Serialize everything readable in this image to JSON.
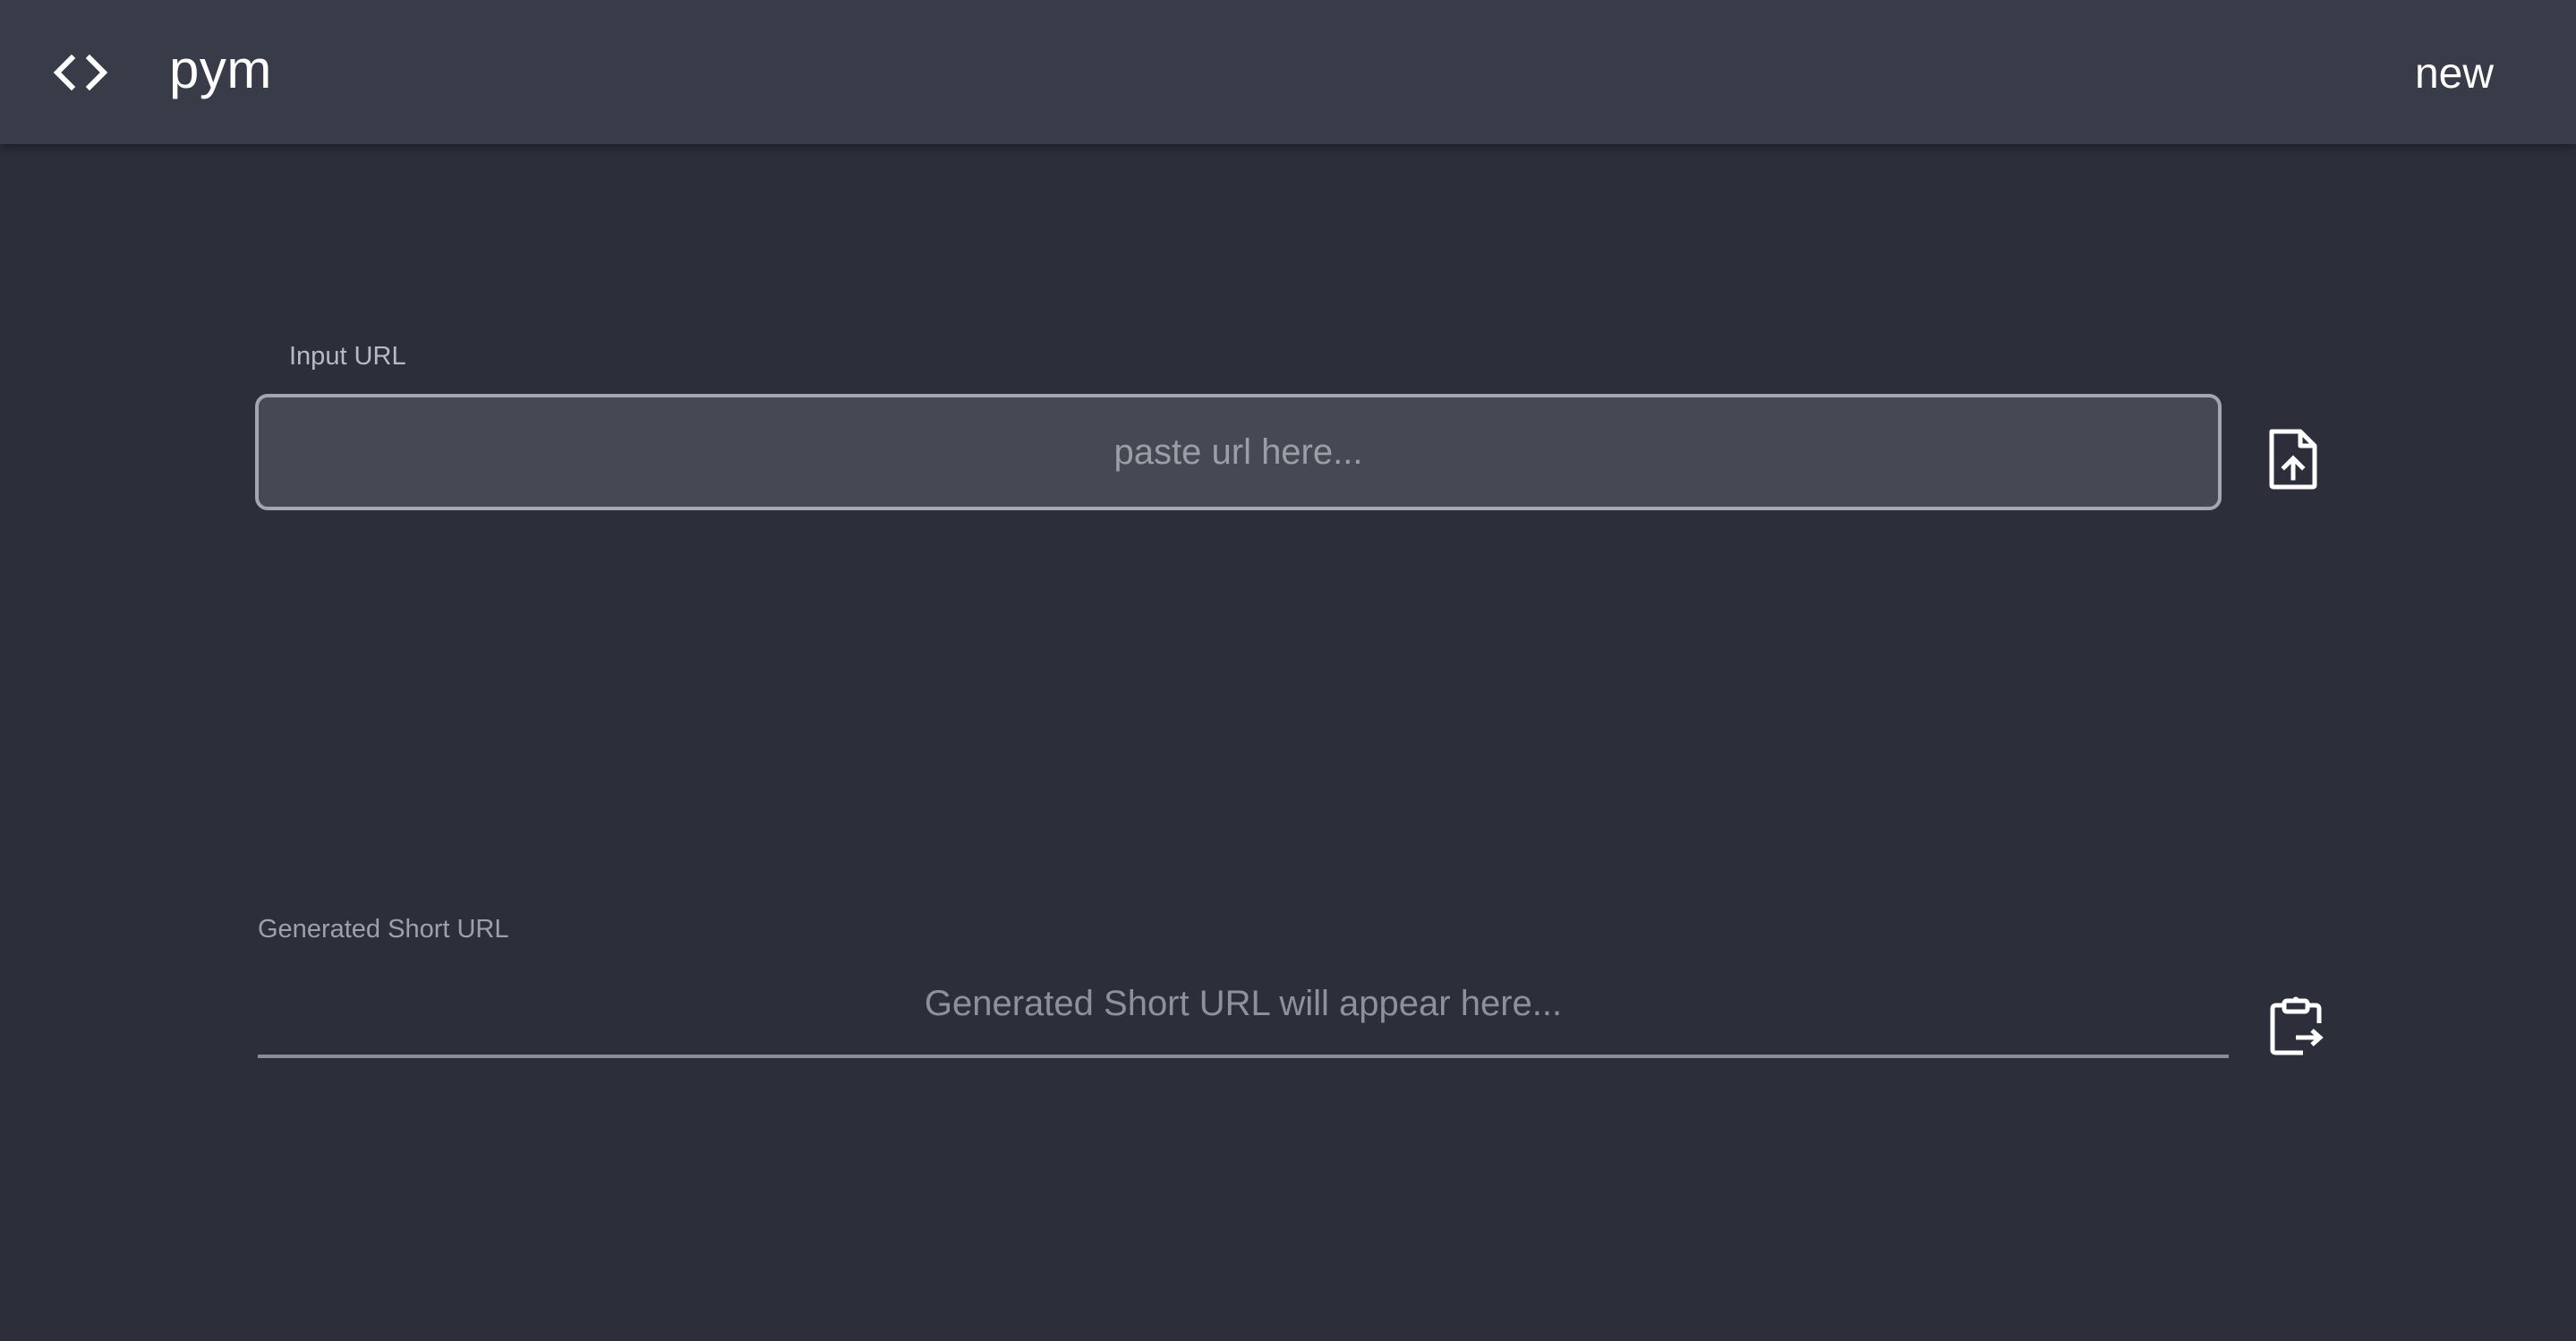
{
  "header": {
    "brand": "pym",
    "new_label": "new",
    "code_icon": "code-brackets-icon"
  },
  "input_section": {
    "label": "Input URL",
    "placeholder": "paste url here...",
    "value": "",
    "action_icon": "file-upload-icon"
  },
  "output_section": {
    "label": "Generated Short URL",
    "placeholder_text": "Generated Short URL will appear here...",
    "action_icon": "clipboard-copy-icon"
  },
  "colors": {
    "background": "#2c2f3a",
    "topbar": "#383b48",
    "input_fill": "#454954",
    "input_border": "#a4a7b0",
    "text_primary": "#ffffff",
    "text_muted": "#9b9ea7"
  }
}
